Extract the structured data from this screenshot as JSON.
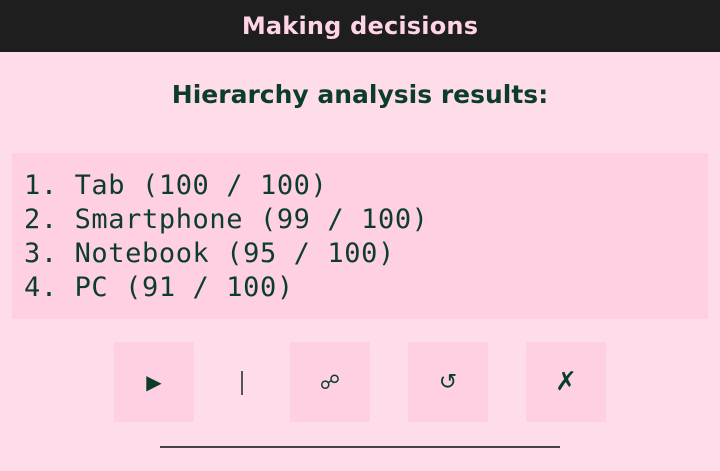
{
  "window": {
    "title": "Making decisions"
  },
  "main": {
    "heading": "Hierarchy analysis results:",
    "results": [
      "1. Tab (100 / 100)",
      "2. Smartphone (99 / 100)",
      "3. Notebook (95 / 100)",
      "4. PC (91 / 100)"
    ]
  },
  "toolbar": {
    "play_icon": "play-icon",
    "play_glyph": "▶",
    "separator_glyph": "|",
    "link_icon": "link-icon",
    "link_glyph": "☍",
    "reset_icon": "reset-icon",
    "reset_glyph": "↺",
    "close_icon": "close-icon",
    "close_glyph": "✗"
  },
  "colors": {
    "background": "#ffdcea",
    "panel": "#ffcfe4",
    "titlebar": "#1e1e1e",
    "title_text": "#ffd4e6",
    "text": "#0b3d2a"
  }
}
